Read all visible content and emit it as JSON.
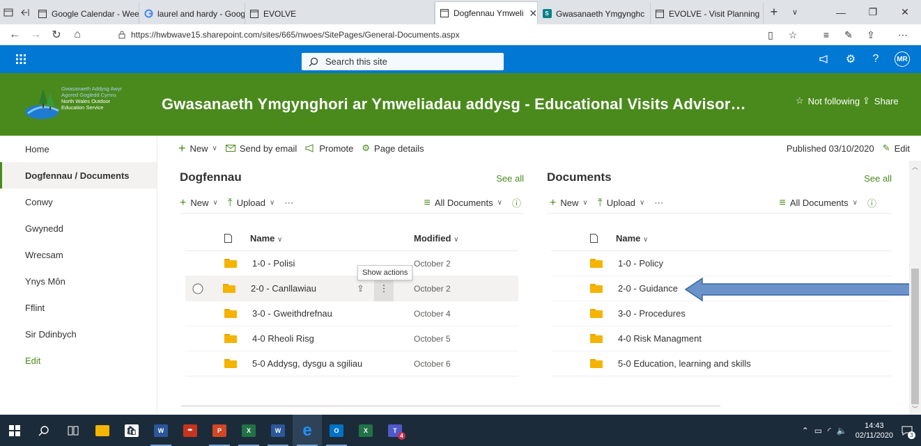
{
  "browser": {
    "tabs": [
      {
        "label": "Google Calendar - Wee",
        "icon": "page-icon"
      },
      {
        "label": "laurel and hardy - Goog",
        "icon": "google-icon"
      },
      {
        "label": "EVOLVE",
        "icon": "page-icon"
      },
      {
        "label": "Dogfennau Ymweli",
        "icon": "page-icon",
        "active": true
      },
      {
        "label": "Gwasanaeth Ymgynghc",
        "icon": "sharepoint-icon"
      },
      {
        "label": "EVOLVE - Visit Planning",
        "icon": "page-icon"
      }
    ],
    "url": "https://hwbwave15.sharepoint.com/sites/665/nwoes/SitePages/General-Documents.aspx"
  },
  "suite": {
    "search_placeholder": "Search this site",
    "avatar": "MR",
    "help": "?"
  },
  "header": {
    "logo_text": "Gwasanaeth Addysg Awyr Agored Gogledd Cymru North Wales Outdoor Education Service",
    "logo_line1": "Gwasanaeth Addysg Awyr",
    "logo_line2": "Agored Gogledd Cymru",
    "logo_line3": "North Wales Outdoor",
    "logo_line4": "Education Service",
    "title": "Gwasanaeth Ymgynghori ar Ymweliadau addysg - Educational Visits Advisory Se...",
    "follow": "Not following",
    "share": "Share"
  },
  "nav": {
    "items": [
      "Home",
      "Dogfennau / Documents",
      "Conwy",
      "Gwynedd",
      "Wrecsam",
      "Ynys Môn",
      "Fflint",
      "Sir Ddinbych"
    ],
    "active": "Dogfennau / Documents",
    "edit": "Edit"
  },
  "commandbar": {
    "new": "New",
    "send": "Send by email",
    "promote": "Promote",
    "details": "Page details",
    "published": "Published 03/10/2020",
    "edit": "Edit"
  },
  "lib_left": {
    "title": "Dogfennau",
    "see_all": "See all",
    "new": "New",
    "upload": "Upload",
    "view": "All Documents",
    "col_name": "Name",
    "col_modified": "Modified",
    "rows": [
      {
        "name": "1-0 - Polisi",
        "modified": "October 2"
      },
      {
        "name": "2-0 - Canllawiau",
        "modified": "October 2"
      },
      {
        "name": "3-0 - Gweithdrefnau",
        "modified": "October 4"
      },
      {
        "name": "4-0 Rheoli Risg",
        "modified": "October 5"
      },
      {
        "name": "5-0 Addysg, dysgu a sgiliau",
        "modified": "October 6"
      }
    ]
  },
  "lib_right": {
    "title": "Documents",
    "see_all": "See all",
    "new": "New",
    "upload": "Upload",
    "view": "All Documents",
    "col_name": "Name",
    "rows": [
      {
        "name": "1-0 - Policy"
      },
      {
        "name": "2-0 - Guidance"
      },
      {
        "name": "3-0 - Procedures"
      },
      {
        "name": "4-0 Risk Managment"
      },
      {
        "name": "5-0 Education, learning and skills"
      }
    ]
  },
  "tooltip": "Show actions",
  "taskbar": {
    "time": "14:43",
    "date": "02/11/2020",
    "notifications": "3",
    "teams_badge": "4"
  },
  "colors": {
    "suite": "#0078d4",
    "header": "#4a8a1c",
    "accent": "#4a8a1c",
    "arrow": "#4f7fbf"
  }
}
